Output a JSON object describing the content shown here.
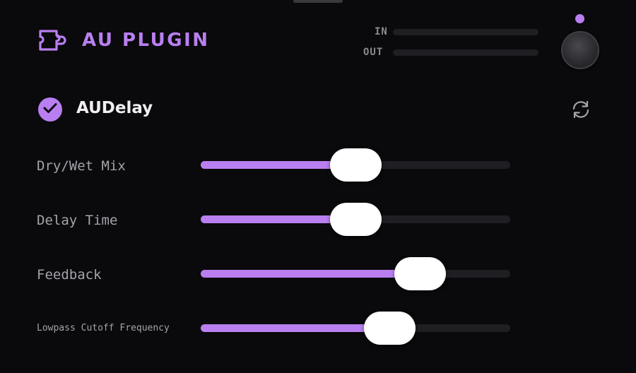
{
  "header": {
    "title": "AU PLUGIN",
    "icon": "puzzle-piece-icon",
    "meters": [
      {
        "label": "IN",
        "level": 0
      },
      {
        "label": "OUT",
        "level": 0
      }
    ]
  },
  "plugin": {
    "name": "AUDelay",
    "enabled": true
  },
  "params": [
    {
      "label": "Dry/Wet Mix",
      "value": 0.5
    },
    {
      "label": "Delay Time",
      "value": 0.5
    },
    {
      "label": "Feedback",
      "value": 0.71
    },
    {
      "label": "Lowpass Cutoff Frequency",
      "value": 0.61
    }
  ],
  "colors": {
    "accent": "#b97ff0",
    "background": "#0a090c",
    "track": "#1f1e22"
  }
}
